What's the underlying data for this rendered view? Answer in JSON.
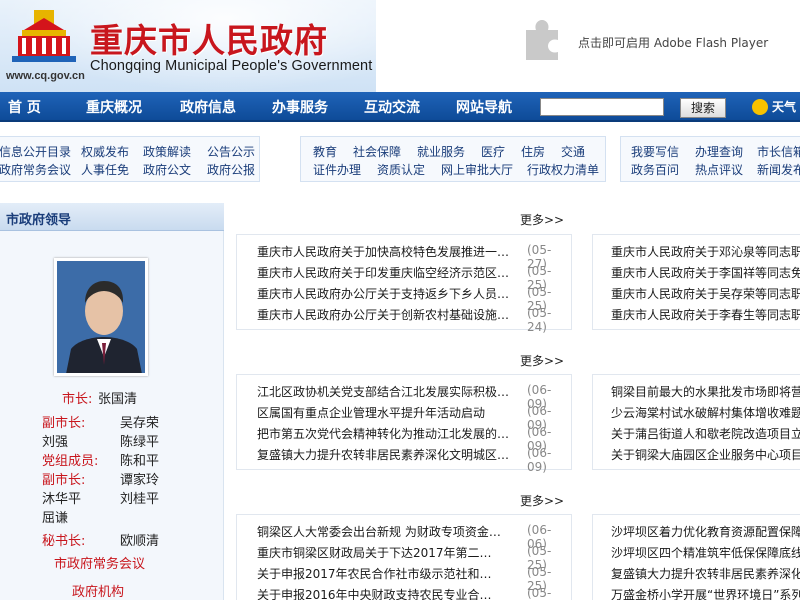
{
  "header": {
    "site_title": "重庆市人民政府",
    "site_en": "Chongqing Municipal People's Government",
    "site_url": "www.cq.gov.cn",
    "flash_text": "点击即可启用 Adobe Flash Player"
  },
  "nav": {
    "items": [
      "首 页",
      "重庆概况",
      "政府信息",
      "办事服务",
      "互动交流",
      "网站导航"
    ],
    "search_button": "搜索",
    "weather": "天气"
  },
  "subnav": {
    "group1_row1": [
      "信息公开目录",
      "权威发布",
      "政策解读",
      "公告公示"
    ],
    "group1_row2": [
      "政府常务会议",
      "人事任免",
      "政府公文",
      "政府公报"
    ],
    "group2_row1": [
      "教育",
      "社会保障",
      "就业服务",
      "医疗",
      "住房",
      "交通"
    ],
    "group2_row2": [
      "证件办理",
      "资质认定",
      "网上审批大厅",
      "行政权力清单"
    ],
    "group3_row1": [
      "我要写信",
      "办理查询",
      "市长信箱"
    ],
    "group3_row2": [
      "政务百问",
      "热点评议",
      "新闻发布"
    ]
  },
  "leaders": {
    "panel_title": "市政府领导",
    "mayor_label": "市长:",
    "mayor_name": "张国清",
    "vice_label": "副市长:",
    "vice_names": [
      "吴存荣",
      "刘强",
      "陈绿平"
    ],
    "party_label": "党组成员:",
    "party_names": [
      "陈和平"
    ],
    "vice2_label": "副市长:",
    "vice2_names": [
      "谭家玲",
      "沐华平",
      "刘桂平",
      "屈谦"
    ],
    "secretary_label": "秘书长:",
    "secretary_name": "欧顺清",
    "council_link": "市政府常务会议",
    "org_link": "政府机构"
  },
  "news": {
    "more_label": "更多>>",
    "block1_left": [
      {
        "title": "重庆市人民政府关于加快高校特色发展推进一…",
        "date": "(05-27)"
      },
      {
        "title": "重庆市人民政府关于印发重庆临空经济示范区…",
        "date": "(05-25)"
      },
      {
        "title": "重庆市人民政府办公厅关于支持返乡下乡人员…",
        "date": "(05-25)"
      },
      {
        "title": "重庆市人民政府办公厅关于创新农村基础设施…",
        "date": "(05-24)"
      }
    ],
    "block1_right": [
      {
        "title": "重庆市人民政府关于邓沁泉等同志职务"
      },
      {
        "title": "重庆市人民政府关于李国祥等同志免职"
      },
      {
        "title": "重庆市人民政府关于吴存荣等同志职务"
      },
      {
        "title": "重庆市人民政府关于李春生等同志职务"
      }
    ],
    "block2_left": [
      {
        "title": "江北区政协机关党支部结合江北发展实际积极…",
        "date": "(06-09)"
      },
      {
        "title": "区属国有重点企业管理水平提升年活动启动",
        "date": "(06-09)"
      },
      {
        "title": "把市第五次党代会精神转化为推动江北发展的…",
        "date": "(06-09)"
      },
      {
        "title": "复盛镇大力提升农转非居民素养深化文明城区…",
        "date": "(06-09)"
      }
    ],
    "block2_right": [
      {
        "title": "铜梁目前最大的水果批发市场即将营业"
      },
      {
        "title": "少云海棠村试水破解村集体增收难题"
      },
      {
        "title": "关于蒲吕街道人和歇老院改造项目立项"
      },
      {
        "title": "关于铜梁大庙园区企业服务中心项目立"
      }
    ],
    "block3_left": [
      {
        "title": "铜梁区人大常委会出台新规 为财政专项资金…",
        "date": "(06-06)"
      },
      {
        "title": "重庆市铜梁区财政局关于下达2017年第二…",
        "date": "(05-25)"
      },
      {
        "title": "关于申报2017年农民合作社市级示范社和…",
        "date": "(05-25)"
      },
      {
        "title": "关于申报2016年中央财政支持农民专业合…",
        "date": "(05-25)"
      }
    ],
    "block3_right": [
      {
        "title": "沙坪坝区着力优化教育资源配置保障教"
      },
      {
        "title": "沙坪坝区四个精准筑牢低保保障底线"
      },
      {
        "title": "复盛镇大力提升农转非居民素养深化文"
      },
      {
        "title": "万盛金桥小学开展“世界环境日”系列主"
      }
    ]
  },
  "colors": {
    "nav_blue": "#1254a6",
    "brand_red": "#c8161d",
    "link_blue": "#1a3d7a"
  }
}
